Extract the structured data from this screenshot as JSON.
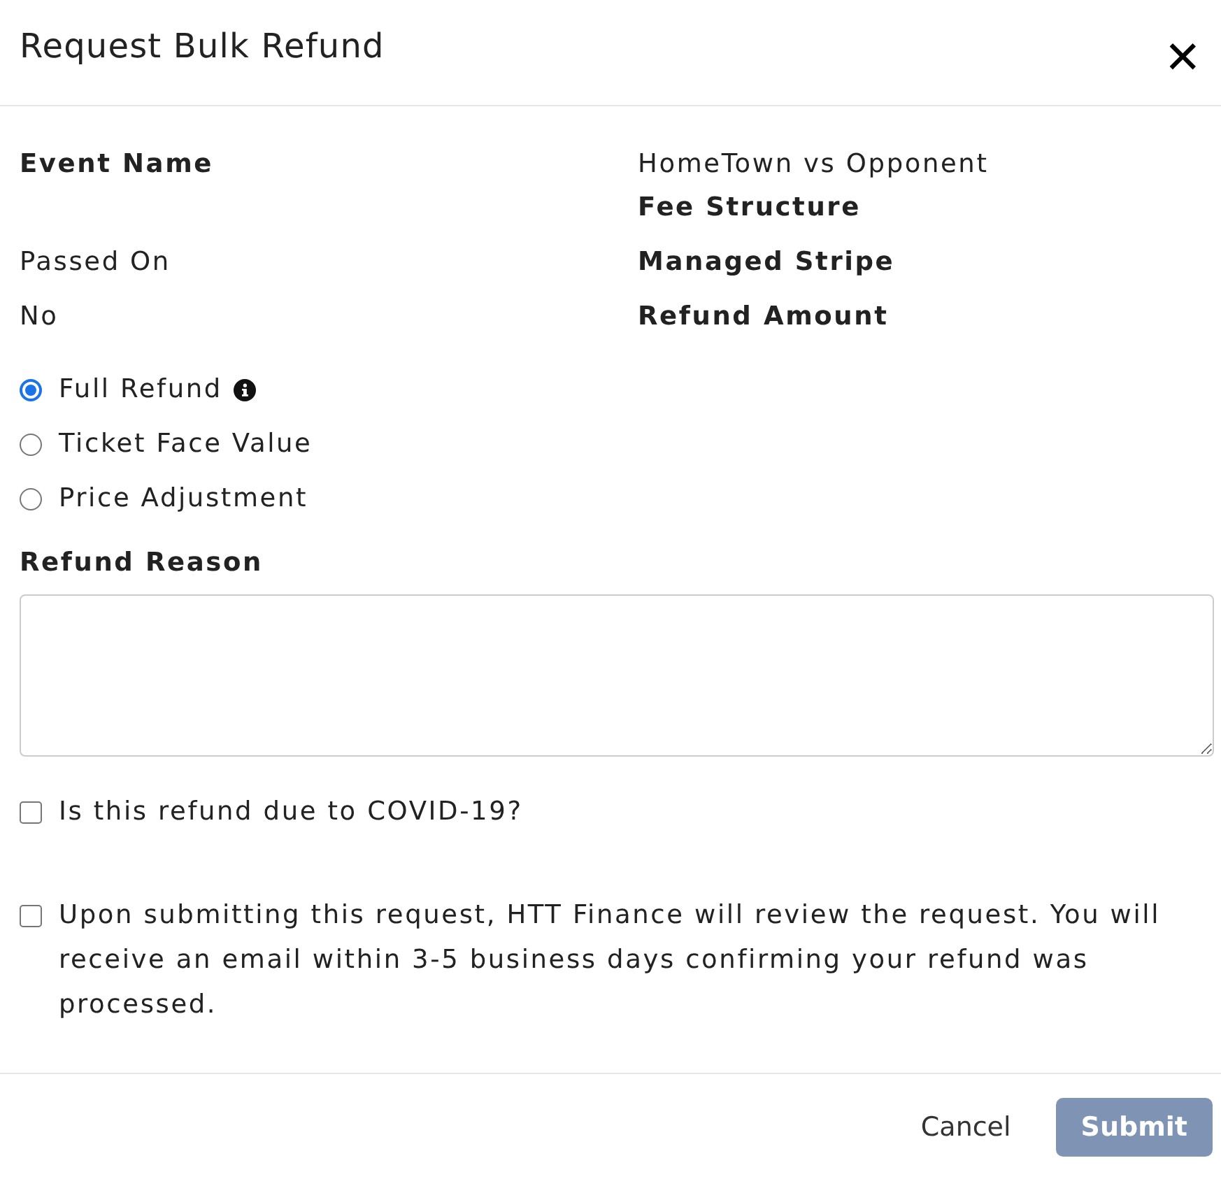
{
  "dialog": {
    "title": "Request Bulk Refund",
    "close": "✕"
  },
  "details": [
    {
      "left": {
        "text": "Event Name",
        "bold": true
      },
      "right": [
        {
          "text": "HomeTown vs Opponent",
          "bold": false
        },
        {
          "text": "Fee Structure",
          "bold": true
        }
      ]
    },
    {
      "left": {
        "text": "Passed On",
        "bold": false
      },
      "right": [
        {
          "text": "Managed Stripe",
          "bold": true
        }
      ]
    },
    {
      "left": {
        "text": "No",
        "bold": false
      },
      "right": [
        {
          "text": "Refund Amount",
          "bold": true
        }
      ]
    }
  ],
  "refund_options": [
    {
      "label": "Full Refund",
      "selected": true,
      "info": true
    },
    {
      "label": "Ticket Face Value",
      "selected": false,
      "info": false
    },
    {
      "label": "Price Adjustment",
      "selected": false,
      "info": false
    }
  ],
  "reason": {
    "label": "Refund Reason"
  },
  "checkboxes": [
    {
      "label": "Is this refund due to COVID-19?",
      "checked": false
    },
    {
      "label": "Upon submitting this request, HTT Finance will review the request. You will receive an email within 3-5 business days confirming your refund was processed.",
      "checked": false
    }
  ],
  "buttons": {
    "cancel": "Cancel",
    "submit": {
      "label": "Submit",
      "disabled": true
    }
  }
}
